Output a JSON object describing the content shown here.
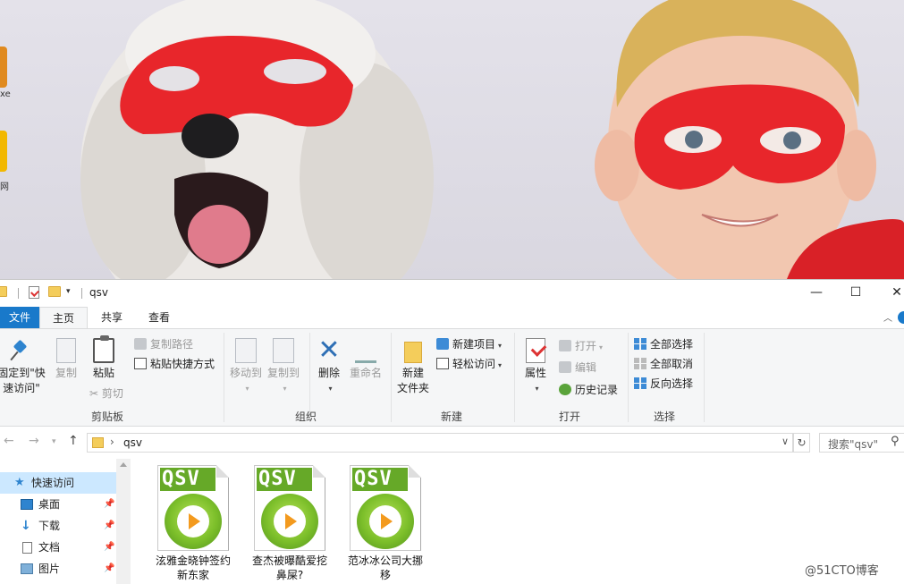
{
  "desktop": {
    "icon_labels": [
      "xe",
      "网"
    ]
  },
  "window": {
    "title": "qsv",
    "controls": {
      "minimize": "—",
      "maximize": "☐",
      "close": "✕"
    }
  },
  "tabs": [
    {
      "label": "文件"
    },
    {
      "label": "主页"
    },
    {
      "label": "共享"
    },
    {
      "label": "查看"
    }
  ],
  "ribbon": {
    "clipboard": {
      "label": "剪贴板",
      "pin_quick_line1": "固定到\"快",
      "pin_quick_line2": "速访问\"",
      "copy": "复制",
      "paste": "粘贴",
      "copy_path": "复制路径",
      "paste_shortcut": "粘贴快捷方式",
      "cut": "剪切"
    },
    "organize": {
      "label": "组织",
      "move_to": "移动到",
      "copy_to": "复制到",
      "delete": "删除",
      "rename": "重命名"
    },
    "new": {
      "label": "新建",
      "new_folder_line1": "新建",
      "new_folder_line2": "文件夹",
      "new_item": "新建项目",
      "easy_access": "轻松访问"
    },
    "open": {
      "label": "打开",
      "properties": "属性",
      "open": "打开",
      "edit": "编辑",
      "history": "历史记录"
    },
    "select": {
      "label": "选择",
      "select_all": "全部选择",
      "select_none": "全部取消",
      "invert": "反向选择"
    }
  },
  "address": {
    "path": "qsv",
    "search_placeholder": "搜索\"qsv\""
  },
  "nav": {
    "items": [
      {
        "label": "快速访问",
        "icon": "star-icon"
      },
      {
        "label": "桌面",
        "icon": "desktop-icon"
      },
      {
        "label": "下载",
        "icon": "download-icon"
      },
      {
        "label": "文档",
        "icon": "document-icon"
      },
      {
        "label": "图片",
        "icon": "picture-icon"
      }
    ]
  },
  "files": [
    {
      "icon_text": "QSV",
      "name_line1": "泫雅金晓钟签约",
      "name_line2": "新东家"
    },
    {
      "icon_text": "QSV",
      "name_line1": "查杰被曝酷爱挖",
      "name_line2": "鼻屎?"
    },
    {
      "icon_text": "QSV",
      "name_line1": "范冰冰公司大挪",
      "name_line2": "移"
    }
  ],
  "watermark": "@51CTO博客",
  "colors": {
    "accent": "#1979ca",
    "qsv_green": "#66a928",
    "play_orange": "#f39a1e",
    "mask_red": "#e8262b"
  }
}
